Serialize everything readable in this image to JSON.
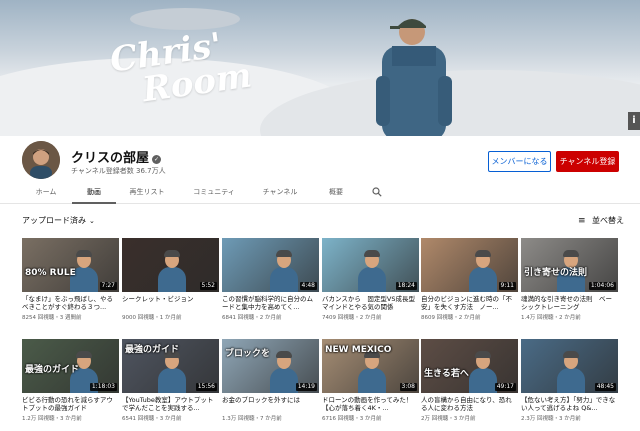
{
  "banner": {
    "logo_line1": "Chris'",
    "logo_line2": "Room",
    "info_icon": "i"
  },
  "channel": {
    "name": "クリスの部屋",
    "verified_icon": "✓",
    "subscribers": "チャンネル登録者数 36.7万人",
    "member_button": "メンバーになる",
    "subscribe_button": "チャンネル登録"
  },
  "tabs": [
    {
      "label": "ホーム"
    },
    {
      "label": "動画"
    },
    {
      "label": "再生リスト"
    },
    {
      "label": "コミュニティ"
    },
    {
      "label": "チャンネル"
    },
    {
      "label": "概要"
    }
  ],
  "search_icon": "search-icon",
  "filter": {
    "label": "アップロード済み",
    "chevron": "⌄"
  },
  "sort": {
    "label": "並べ替え",
    "icon": "≡"
  },
  "videos": [
    {
      "title": "「なまけ」をぶっ飛ばし、やるべきことがすぐ終わる３つ...",
      "meta": "8254 回視聴・3 週間前",
      "duration": "7:27",
      "caption": "80% RULE",
      "bg": "#7a6f63"
    },
    {
      "title": "シークレット・ビジョン",
      "meta": "9000 回視聴・1 か月前",
      "duration": "5:52",
      "caption": "",
      "bg": "#3a2f2b"
    },
    {
      "title": "この習慣が脳科学的に自分のムードと集中力を高めてく...",
      "meta": "6841 回視聴・2 か月前",
      "duration": "4:48",
      "caption": "",
      "bg": "#6e9bb6"
    },
    {
      "title": "バカンスから　固定型VS成長型マインドとやる気の関係",
      "meta": "7409 回視聴・2 か月前",
      "duration": "18:24",
      "caption": "",
      "bg": "#7db3c9"
    },
    {
      "title": "自分のビジョンに進む時の「不安」を失くす方法　ノー...",
      "meta": "8609 回視聴・2 か月前",
      "duration": "9:11",
      "caption": "",
      "bg": "#b0896a"
    },
    {
      "title": "魂満的な引き寄せの法則　ベーシックトレーニング",
      "meta": "1.4万 回視聴・2 か月前",
      "duration": "1:04:06",
      "caption": "引き寄せの法則",
      "bg": "#8d8b88"
    },
    {
      "title": "ビビる行動の恐れを減らすアウトプットの最強ガイド",
      "meta": "1.2万 回視聴・3 か月前",
      "duration": "1:18:03",
      "caption": "最強のガイド",
      "bg": "#4b5b49"
    },
    {
      "title": "【YouTube教室】アウトプットで学んだことを実践する...",
      "meta": "6541 回視聴・3 か月前",
      "duration": "15:56",
      "caption": "最強のガイド",
      "bg": "#4f5560"
    },
    {
      "title": "お金のブロックを外すには",
      "meta": "1.3万 回視聴・7 か月前",
      "duration": "14:19",
      "caption": "ブロックを",
      "bg": "#8fa6b6"
    },
    {
      "title": "ドローンの動画を作ってみた！【心が落ち着く4K・...",
      "meta": "6716 回視聴・3 か月前",
      "duration": "3:08",
      "caption": "NEW MEXICO",
      "bg": "#a58d74"
    },
    {
      "title": "人の盲構から自由になり、恐れる人に変わる方法",
      "meta": "2万 回視聴・3 か月前",
      "duration": "49:17",
      "caption": "生きる若へ",
      "bg": "#5d4d45"
    },
    {
      "title": "【危ない考え方】「努力」できない人って逃げるよね Q&...",
      "meta": "2.3万 回視聴・3 か月前",
      "duration": "48:45",
      "caption": "",
      "bg": "#4a6b86"
    }
  ]
}
